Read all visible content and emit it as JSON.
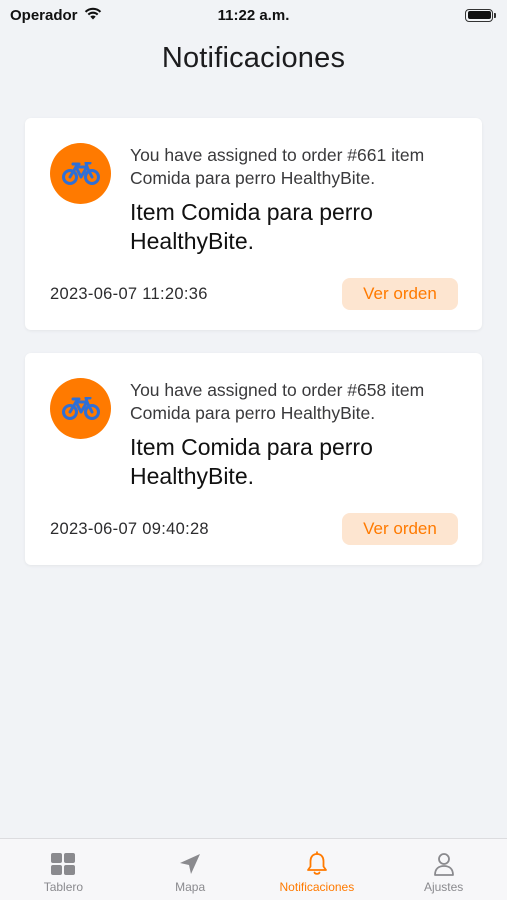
{
  "status_bar": {
    "carrier": "Operador",
    "time": "11:22 a.m."
  },
  "header": {
    "title": "Notificaciones"
  },
  "notifications": [
    {
      "icon": "bicycle-icon",
      "message": "You have assigned to order #661 item Comida para perro HealthyBite.",
      "heading": "Item Comida para perro HealthyBite.",
      "date": "2023-06-07 11:20:36",
      "button_label": "Ver orden"
    },
    {
      "icon": "bicycle-icon",
      "message": "You have assigned to order #658 item Comida para perro HealthyBite.",
      "heading": "Item Comida para perro HealthyBite.",
      "date": "2023-06-07 09:40:28",
      "button_label": "Ver orden"
    }
  ],
  "tab_bar": {
    "tabs": [
      {
        "label": "Tablero",
        "icon": "grid-icon",
        "active": false
      },
      {
        "label": "Mapa",
        "icon": "location-arrow-icon",
        "active": false
      },
      {
        "label": "Notificaciones",
        "icon": "bell-icon",
        "active": true
      },
      {
        "label": "Ajustes",
        "icon": "person-icon",
        "active": false
      }
    ]
  },
  "colors": {
    "accent": "#ff7a00",
    "accent_soft": "#fde5d0",
    "background": "#f1f3f6",
    "bike_icon": "#2f6fd6",
    "tab_inactive": "#8a8a8e"
  }
}
